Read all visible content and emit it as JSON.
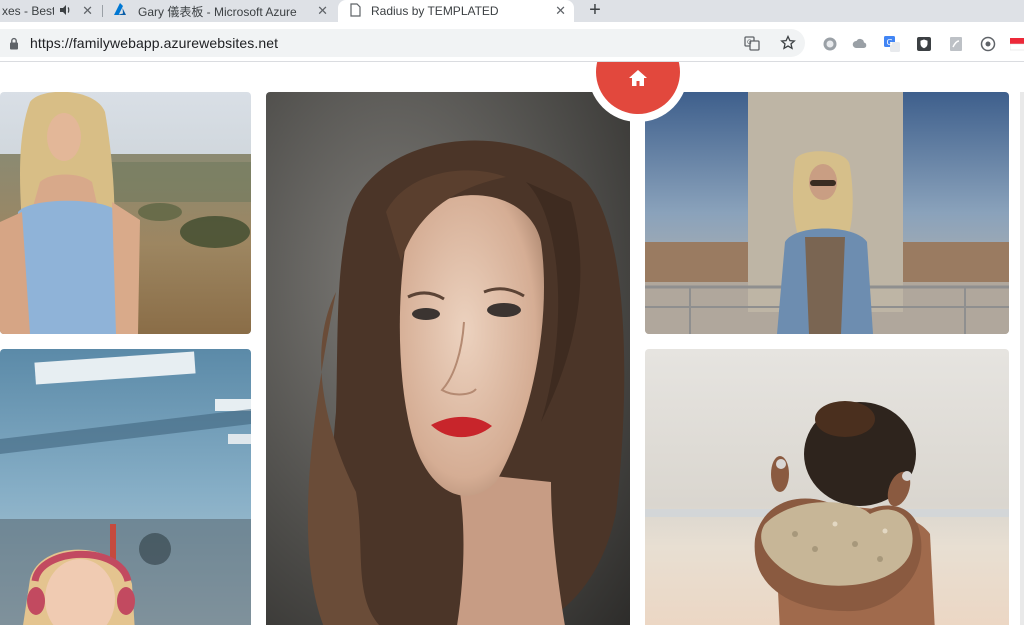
{
  "browser": {
    "tabs": [
      {
        "title": "xes - Best",
        "audio": true
      },
      {
        "title": "Gary 儀表板 - Microsoft Azure"
      },
      {
        "title": "Radius by TEMPLATED",
        "active": true
      }
    ],
    "url": "https://familywebapp.azurewebsites.net",
    "extensions": [
      "extension-icon-1",
      "extension-icon-2",
      "google-translate-extension-icon",
      "shield-extension-icon",
      "pdf-extension-icon",
      "eye-extension-icon",
      "flag-extension-icon"
    ]
  },
  "gallery": {
    "home_icon": "home-icon",
    "photos": [
      {
        "name": "photo-blonde-woman-field"
      },
      {
        "name": "photo-woman-red-lips-portrait"
      },
      {
        "name": "photo-woman-denim-jacket-balcony"
      },
      {
        "name": "photo-woman-headphones-office"
      },
      {
        "name": "photo-hands-holding-sand"
      }
    ]
  },
  "colors": {
    "accent": "#e2483d",
    "tabstrip": "#dee1e6",
    "omnibox": "#f1f3f4"
  }
}
